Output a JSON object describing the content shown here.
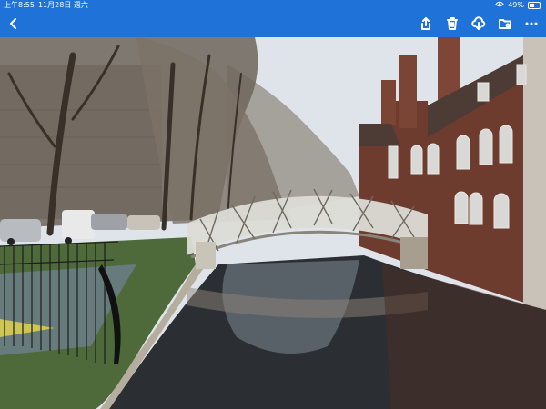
{
  "status_bar": {
    "time": "上午8:55",
    "date": "11月28日 週六",
    "battery_text": "49%",
    "battery_level": 0.49,
    "icons": [
      "eye-icon",
      "battery-icon",
      "dots-icon"
    ]
  },
  "toolbar": {
    "icons": [
      "back-chevron-icon",
      "share-icon",
      "trash-icon",
      "download-cloud-icon",
      "folder-icon",
      "more-icon"
    ]
  },
  "photo": {
    "subject": "Mathematical Bridge over the river Cam"
  },
  "colors": {
    "accent": "#1f73d8",
    "sky": "#dde3ea",
    "water": "#2a2f33",
    "brick": "#7a4636"
  }
}
